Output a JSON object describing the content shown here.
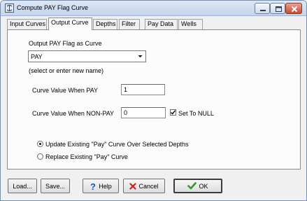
{
  "window": {
    "title": "Compute PAY Flag Curve"
  },
  "tabs": [
    {
      "label": "Input Curves",
      "active": false
    },
    {
      "label": "Output Curve",
      "active": true
    },
    {
      "label": "Depths",
      "active": false
    },
    {
      "label": "Filter",
      "active": false
    },
    {
      "label": "Pay Data",
      "active": false
    },
    {
      "label": "Wells",
      "active": false
    }
  ],
  "output_curve": {
    "output_label": "Output PAY  Flag as Curve",
    "curve_name_value": "PAY",
    "curve_name_hint": "(select or enter new name)",
    "pay_value_label": "Curve Value When PAY",
    "pay_value": "1",
    "nonpay_value_label": "Curve Value When NON-PAY",
    "nonpay_value": "0",
    "set_to_null_label": "Set To NULL",
    "set_to_null_checked": true,
    "option_update_label": "Update Existing \"Pay\" Curve Over Selected Depths",
    "option_replace_label": "Replace Existing \"Pay\" Curve",
    "selected_option": "update"
  },
  "buttons": {
    "load": "Load...",
    "save": "Save...",
    "help": "Help",
    "cancel": "Cancel",
    "ok": "OK"
  },
  "colors": {
    "help_icon": "#1d4fb8",
    "cancel_icon": "#c8231b",
    "ok_icon": "#2f9a2a"
  }
}
